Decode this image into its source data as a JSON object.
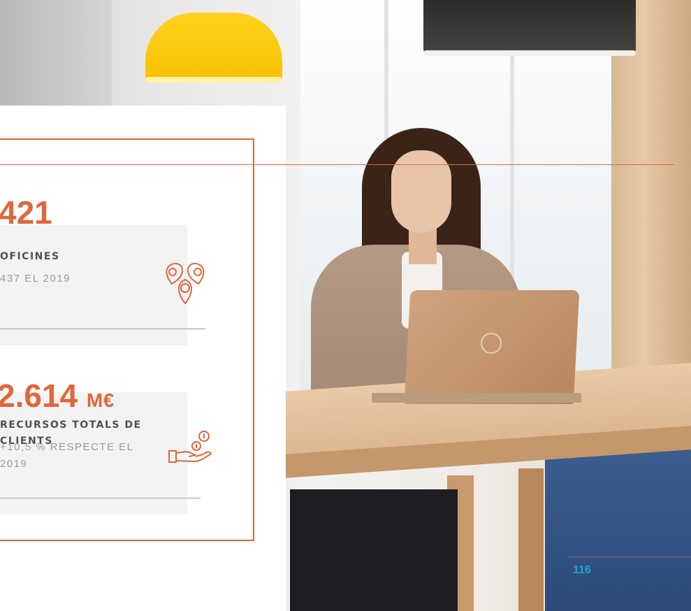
{
  "stats": [
    {
      "value": "421",
      "label": "OFICINES",
      "comparison": "437 EL 2019",
      "icon": "location-pins-icon"
    },
    {
      "value": "2.614",
      "unit": "M€",
      "label": "RECURSOS TOTALS DE CLIENTS",
      "comparison": "+10,5 % RESPECTE EL 2019",
      "icon": "hand-coins-icon"
    }
  ],
  "page": {
    "number": "116"
  },
  "colors": {
    "accent": "#e0673a",
    "page_number": "#1fa3d8",
    "box_background": "#f3f3f3"
  }
}
